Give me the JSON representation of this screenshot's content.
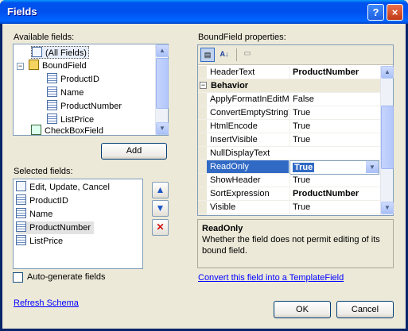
{
  "window": {
    "title": "Fields",
    "help_glyph": "?",
    "close_glyph": "×"
  },
  "available": {
    "label": "Available fields:",
    "tree": [
      {
        "label": "(All Fields)",
        "icon": "all-fields-icon"
      },
      {
        "label": "BoundField",
        "icon": "boundfield-icon",
        "expander": "−"
      },
      {
        "label": "ProductID",
        "icon": "field-icon"
      },
      {
        "label": "Name",
        "icon": "field-icon"
      },
      {
        "label": "ProductNumber",
        "icon": "field-icon"
      },
      {
        "label": "ListPrice",
        "icon": "field-icon"
      },
      {
        "label": "CheckBoxField",
        "icon": "checkboxfield-icon"
      }
    ],
    "add_button": "Add"
  },
  "selected": {
    "label": "Selected fields:",
    "items": [
      "Edit, Update, Cancel",
      "ProductID",
      "Name",
      "ProductNumber",
      "ListPrice"
    ],
    "selected_index": 3,
    "up_glyph": "▲",
    "down_glyph": "▼",
    "delete_glyph": "✕"
  },
  "properties": {
    "label": "BoundField properties:",
    "rows": [
      {
        "name": "HeaderText",
        "value": "ProductNumber",
        "bold": true
      },
      {
        "category": "Behavior",
        "expander": "−"
      },
      {
        "name": "ApplyFormatInEditMode",
        "value": "False"
      },
      {
        "name": "ConvertEmptyStringToNull",
        "value": "True"
      },
      {
        "name": "HtmlEncode",
        "value": "True"
      },
      {
        "name": "InsertVisible",
        "value": "True"
      },
      {
        "name": "NullDisplayText",
        "value": ""
      },
      {
        "name": "ReadOnly",
        "value": "True",
        "selected": true
      },
      {
        "name": "ShowHeader",
        "value": "True"
      },
      {
        "name": "SortExpression",
        "value": "ProductNumber",
        "bold": true
      },
      {
        "name": "Visible",
        "value": "True"
      }
    ],
    "description": {
      "title": "ReadOnly",
      "text": "Whether the field does not permit editing of its bound field."
    }
  },
  "auto_generate": {
    "label": "Auto-generate fields",
    "checked": false
  },
  "links": {
    "convert": "Convert this field into a TemplateField",
    "refresh": "Refresh Schema"
  },
  "buttons": {
    "ok": "OK",
    "cancel": "Cancel"
  },
  "colors": {
    "title_blue": "#0053ee",
    "selection": "#316ac5",
    "link": "#0000ff"
  }
}
